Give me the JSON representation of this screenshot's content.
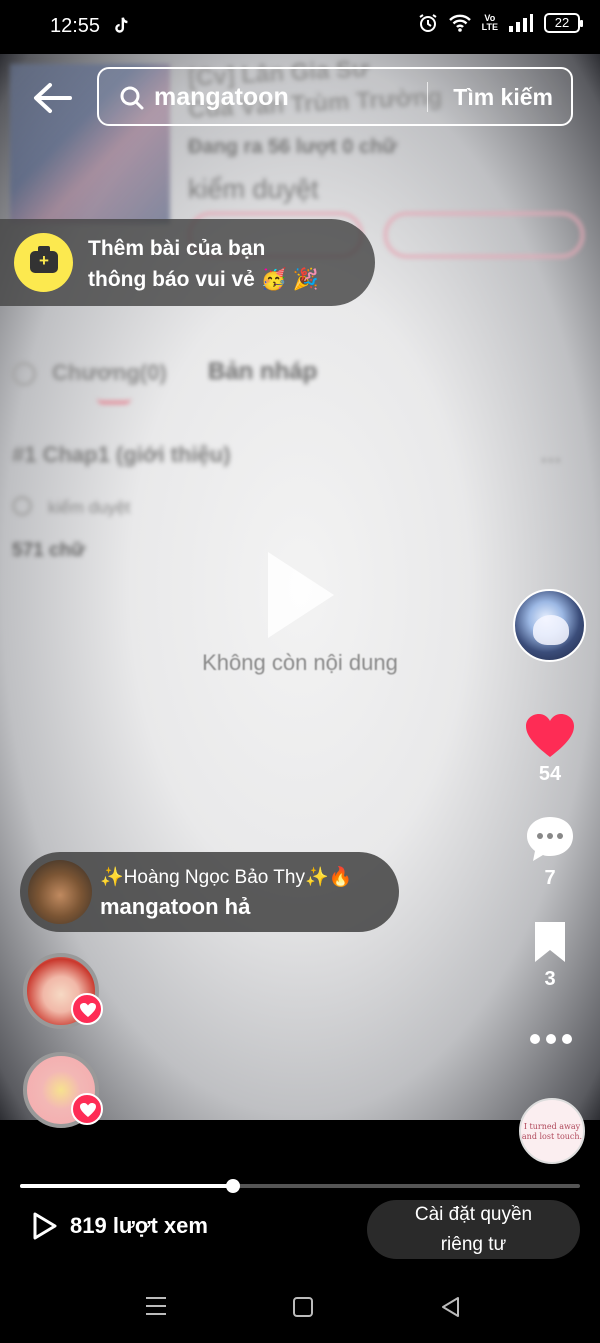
{
  "status_bar": {
    "time": "12:55",
    "network_label_top": "Vo",
    "network_label_bottom": "LTE",
    "battery": "22"
  },
  "search": {
    "query": "mangatoon",
    "button_label": "Tìm kiếm"
  },
  "notification": {
    "line1": "Thêm bài của bạn",
    "line2": "thông báo vui vẻ 🥳 🎉"
  },
  "video": {
    "blurred_background": {
      "title_line1": "[Cv] Lân Gia Sư",
      "title_line2": "Của Vân Trùm Trường",
      "meta": "Đang ra  56 lượt 0 chữ",
      "status": "kiểm duyệt",
      "tab_chapters": "Chương(0)",
      "tab_drafts": "Bản nháp",
      "chapter_title": "#1  Chap1 (giới thiệu)",
      "chapter_status": "kiểm duyệt",
      "chapter_words": "571 chữ"
    },
    "empty_message": "Không còn nội dung"
  },
  "actions": {
    "likes": "54",
    "comments": "7",
    "saves": "3"
  },
  "comment": {
    "username": "✨Hoàng Ngọc Bảo Thy✨🔥",
    "text": "mangatoon hả"
  },
  "sound_disc_text": "I turned away and lost touch.",
  "progress": {
    "fraction": 0.38
  },
  "footer": {
    "views": "819 lượt xem",
    "privacy_line1": "Cài đặt quyền",
    "privacy_line2": "riêng tư"
  },
  "colors": {
    "like": "#fe2c55",
    "notif_icon": "#fce94f"
  }
}
